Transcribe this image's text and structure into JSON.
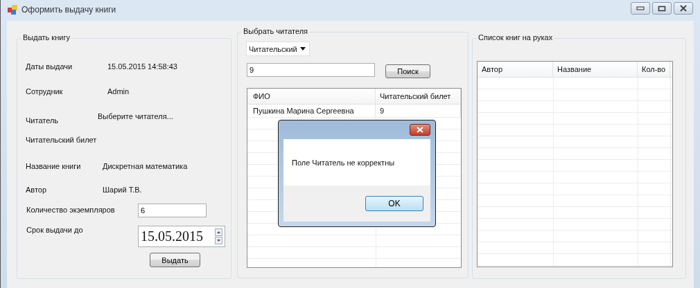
{
  "window": {
    "title": "Оформить выдачу книги"
  },
  "issue_group": {
    "title": "Выдать книгу",
    "fields": [
      {
        "label": "Даты выдачи",
        "value": "15.05.2015 14:58:43"
      },
      {
        "label": "Сотрудник",
        "value": "Admin"
      },
      {
        "label": "Читатель",
        "value": "Выберите читателя..."
      },
      {
        "label": "Читательский билет"
      },
      {
        "label": "Название книги",
        "value": "Дискретная математика"
      },
      {
        "label": "Автор",
        "value": "Шарий Т.В."
      }
    ],
    "copies": {
      "label": "Количество экземпляров",
      "value": "6"
    },
    "due_date": {
      "label": "Срок выдачи до",
      "value": "15.05.2015"
    },
    "issue_button": "Выдать"
  },
  "reader_group": {
    "title": "Выбрать читателя",
    "search_by": "Читательский",
    "query": "9",
    "search_button": "Поиск",
    "table": {
      "columns": [
        "ФИО",
        "Читательский билет"
      ],
      "rows": [
        [
          "Пушкина Марина Сергеевна",
          "9"
        ]
      ]
    }
  },
  "books_group": {
    "title": "Список книг на руках",
    "table": {
      "columns": [
        "Автор",
        "Название",
        "Кол-во"
      ]
    }
  },
  "dialog": {
    "message": "Поле Читатель не корректны",
    "button": "OK"
  }
}
